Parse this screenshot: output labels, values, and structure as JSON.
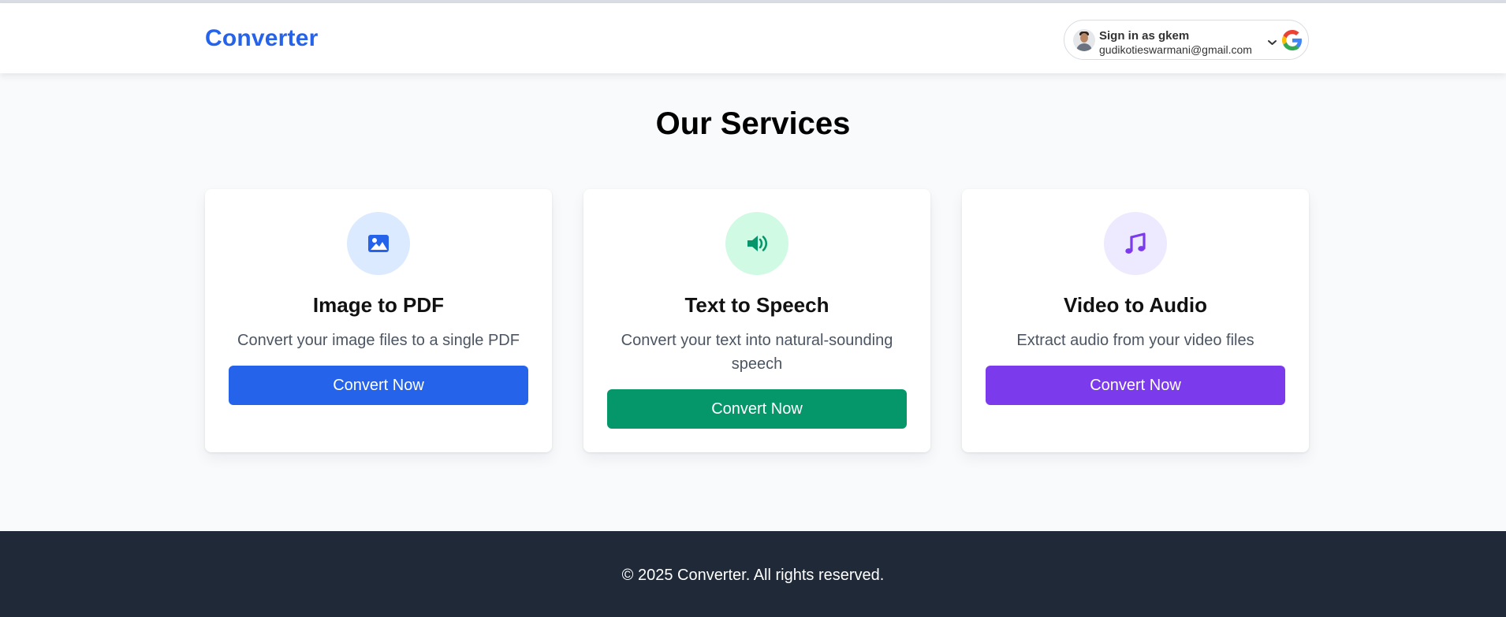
{
  "header": {
    "brand": "Converter",
    "account": {
      "title": "Sign in as gkem",
      "email": "gudikotieswarmani@gmail.com"
    }
  },
  "main": {
    "title": "Our Services",
    "services": [
      {
        "title": "Image to PDF",
        "description": "Convert your image files to a single PDF",
        "button": "Convert Now",
        "icon": "image-icon",
        "accent": "#2563eb",
        "icon_bg": "#dbeafe"
      },
      {
        "title": "Text to Speech",
        "description": "Convert your text into natural-sounding speech",
        "button": "Convert Now",
        "icon": "speaker-icon",
        "accent": "#059669",
        "icon_bg": "#d1fae5"
      },
      {
        "title": "Video to Audio",
        "description": "Extract audio from your video files",
        "button": "Convert Now",
        "icon": "music-note-icon",
        "accent": "#7c3aed",
        "icon_bg": "#ede9fe"
      }
    ]
  },
  "footer": {
    "copyright": "© 2025 Converter. All rights reserved."
  }
}
